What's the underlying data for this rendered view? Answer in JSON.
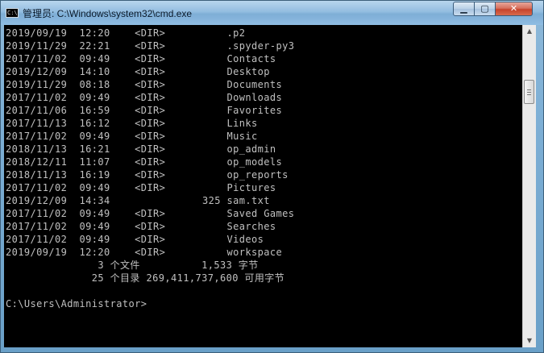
{
  "window": {
    "title": "管理员: C:\\Windows\\system32\\cmd.exe",
    "icon_label": "C:\\",
    "controls": {
      "minimize": "▁",
      "maximize": "▢",
      "close": "✕"
    }
  },
  "console": {
    "lines": [
      "2019/09/19  12:20    <DIR>          .p2",
      "2019/11/29  22:21    <DIR>          .spyder-py3",
      "2017/11/02  09:49    <DIR>          Contacts",
      "2019/12/09  14:10    <DIR>          Desktop",
      "2019/11/29  08:18    <DIR>          Documents",
      "2017/11/02  09:49    <DIR>          Downloads",
      "2017/11/06  16:59    <DIR>          Favorites",
      "2017/11/13  16:12    <DIR>          Links",
      "2017/11/02  09:49    <DIR>          Music",
      "2018/11/13  16:21    <DIR>          op_admin",
      "2018/12/11  11:07    <DIR>          op_models",
      "2018/11/13  16:19    <DIR>          op_reports",
      "2017/11/02  09:49    <DIR>          Pictures",
      "2019/12/09  14:34               325 sam.txt",
      "2017/11/02  09:49    <DIR>          Saved Games",
      "2017/11/02  09:49    <DIR>          Searches",
      "2017/11/02  09:49    <DIR>          Videos",
      "2019/09/19  12:20    <DIR>          workspace",
      "               3 个文件          1,533 字节",
      "              25 个目录 269,411,737,600 可用字节",
      "",
      "C:\\Users\\Administrator>"
    ]
  },
  "scrollbar": {
    "up_arrow": "▲",
    "down_arrow": "▼"
  },
  "colors": {
    "console_bg": "#000000",
    "console_text": "#c0c0c0",
    "close_button": "#c7432b"
  }
}
